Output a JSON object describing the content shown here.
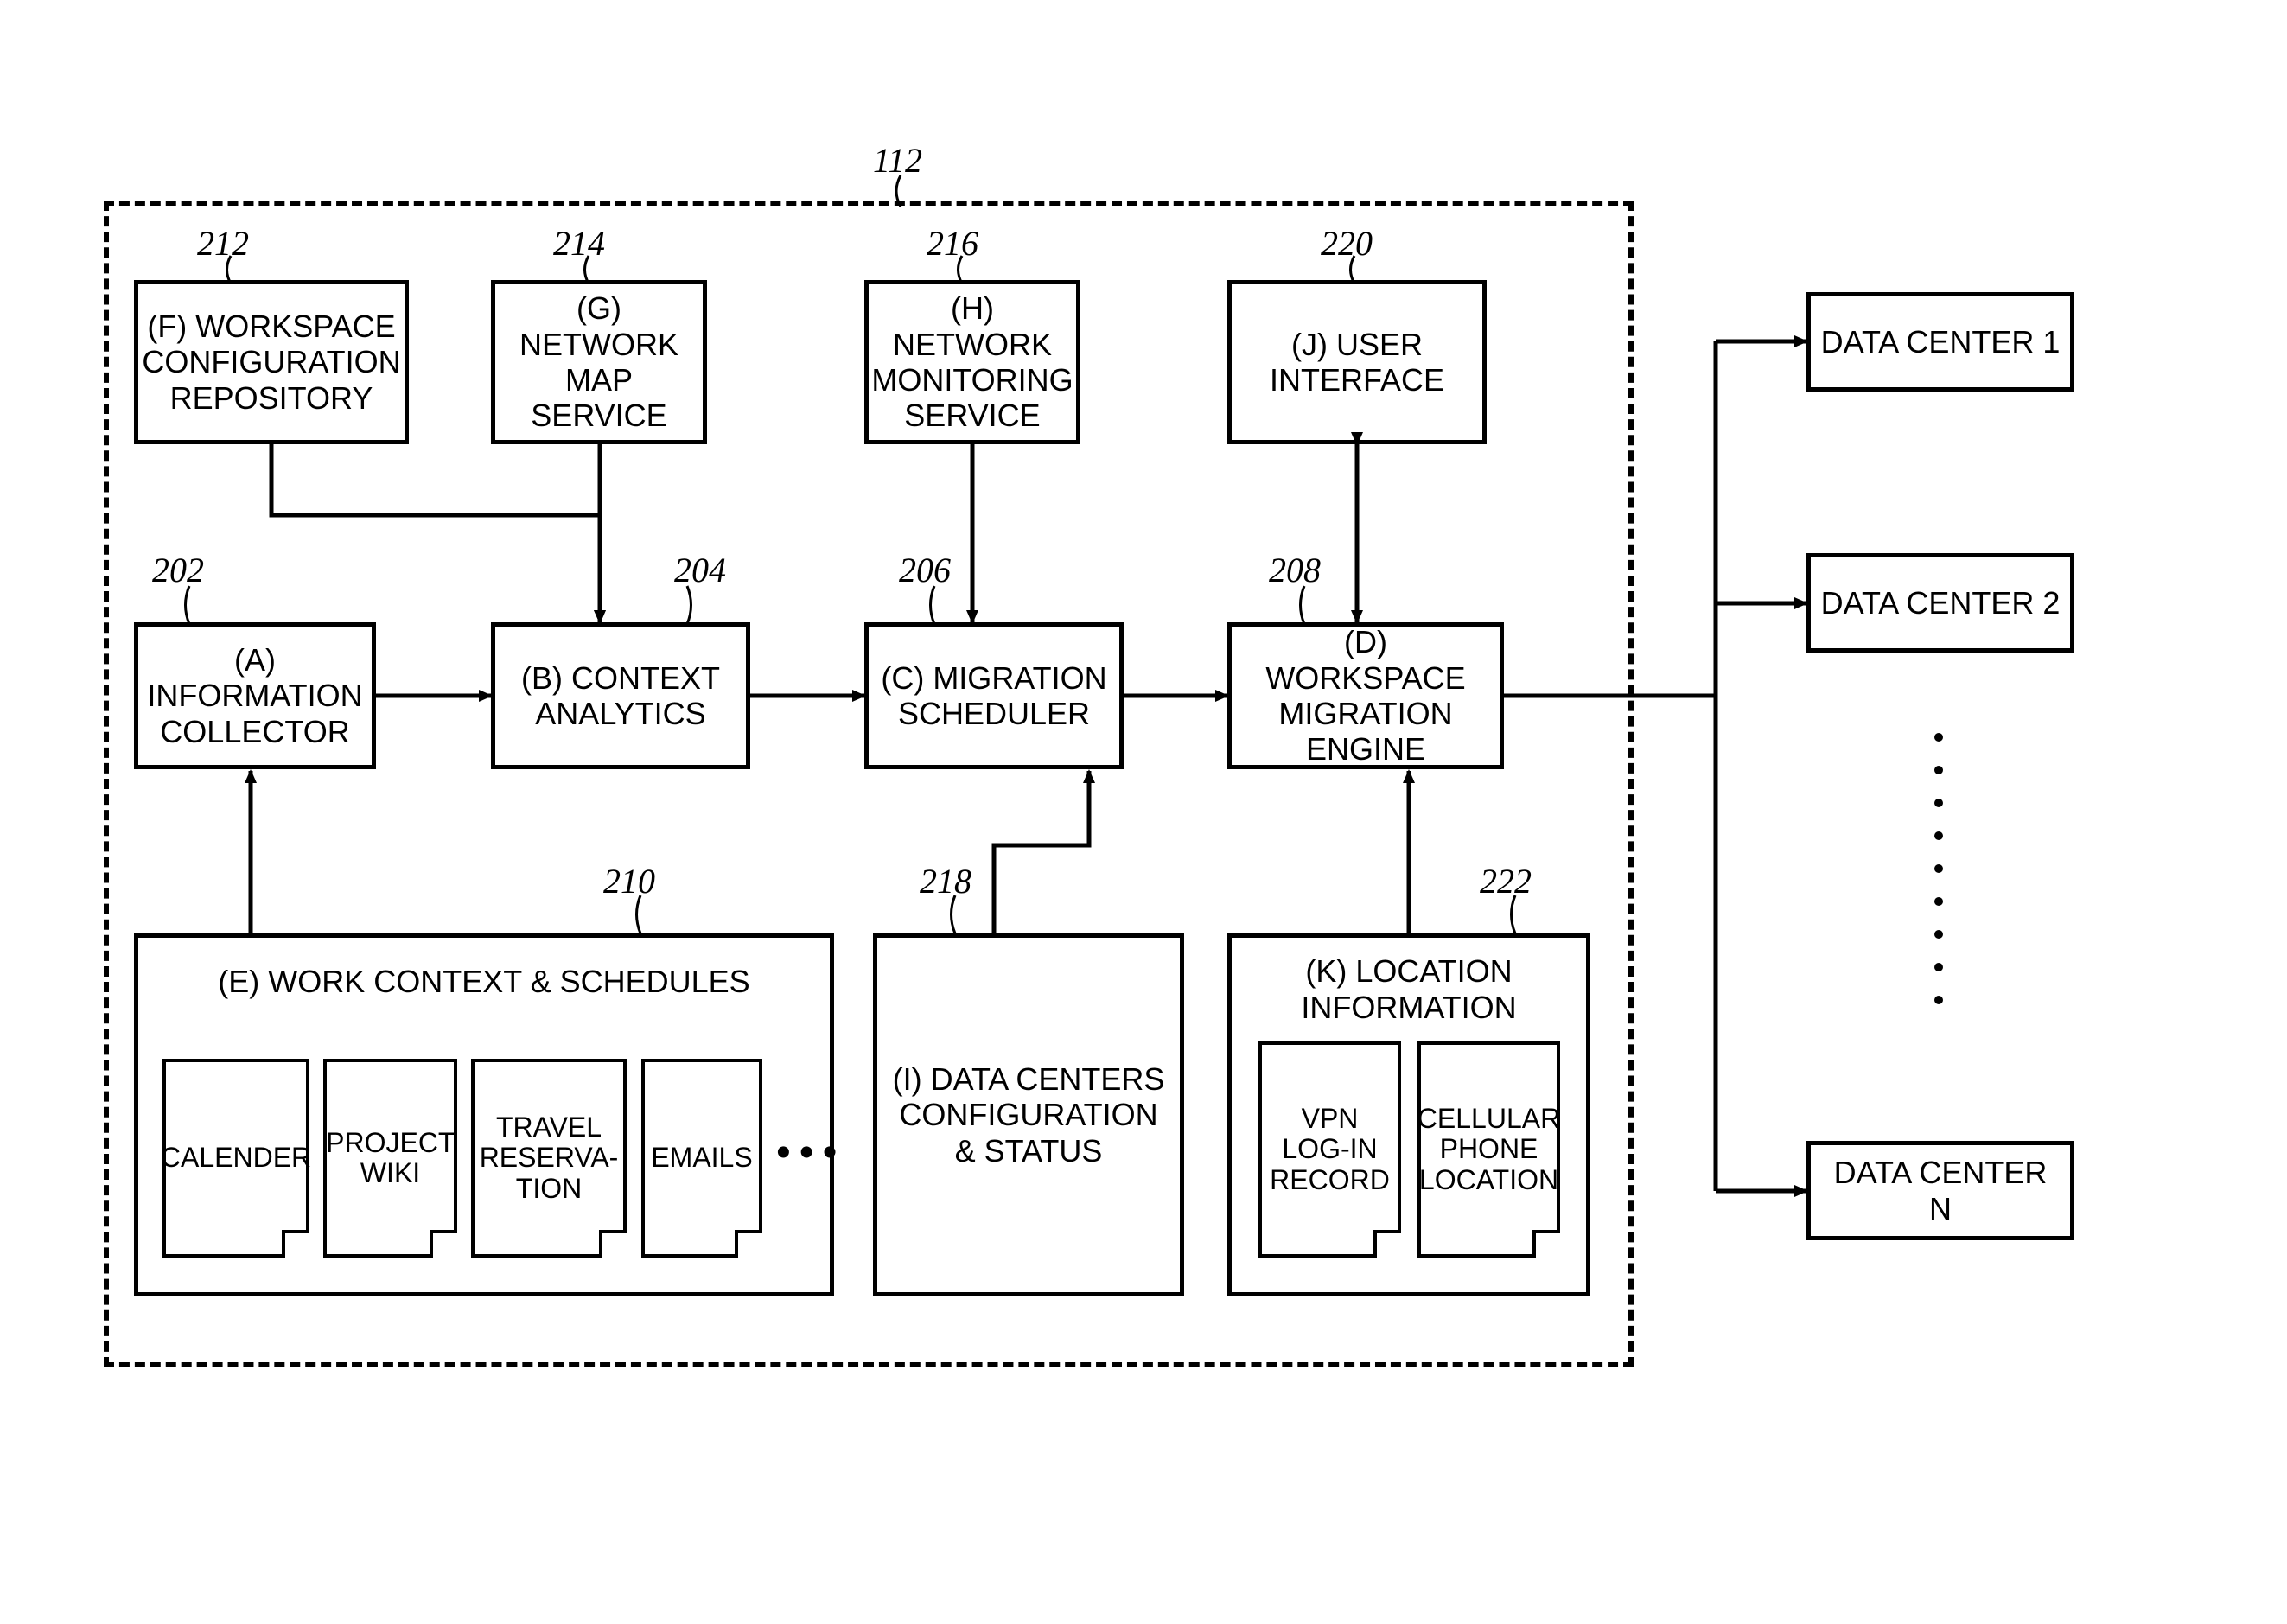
{
  "container_ref": "112",
  "blocks": {
    "f": {
      "ref": "212",
      "label": "(F) WORKSPACE CONFIGURATION REPOSITORY"
    },
    "g": {
      "ref": "214",
      "label": "(G) NETWORK MAP SERVICE"
    },
    "h": {
      "ref": "216",
      "label": "(H) NETWORK MONITORING SERVICE"
    },
    "j": {
      "ref": "220",
      "label": "(J) USER INTERFACE"
    },
    "a": {
      "ref": "202",
      "label": "(A) INFORMATION COLLECTOR"
    },
    "b": {
      "ref": "204",
      "label": "(B) CONTEXT ANALYTICS"
    },
    "c": {
      "ref": "206",
      "label": "(C) MIGRATION SCHEDULER"
    },
    "d": {
      "ref": "208",
      "label": "(D) WORKSPACE MIGRATION ENGINE"
    },
    "e": {
      "ref": "210",
      "title": "(E) WORK CONTEXT & SCHEDULES",
      "docs": [
        "CALENDER",
        "PROJECT WIKI",
        "TRAVEL RESERVA-TION",
        "EMAILS"
      ]
    },
    "i": {
      "ref": "218",
      "label": "(I) DATA CENTERS CONFIGURATION & STATUS"
    },
    "k": {
      "ref": "222",
      "title": "(K) LOCATION INFORMATION",
      "docs": [
        "VPN LOG-IN RECORD",
        "CELLULAR PHONE LOCATION"
      ]
    }
  },
  "data_centers": [
    "DATA CENTER 1",
    "DATA CENTER 2",
    "DATA CENTER N"
  ]
}
